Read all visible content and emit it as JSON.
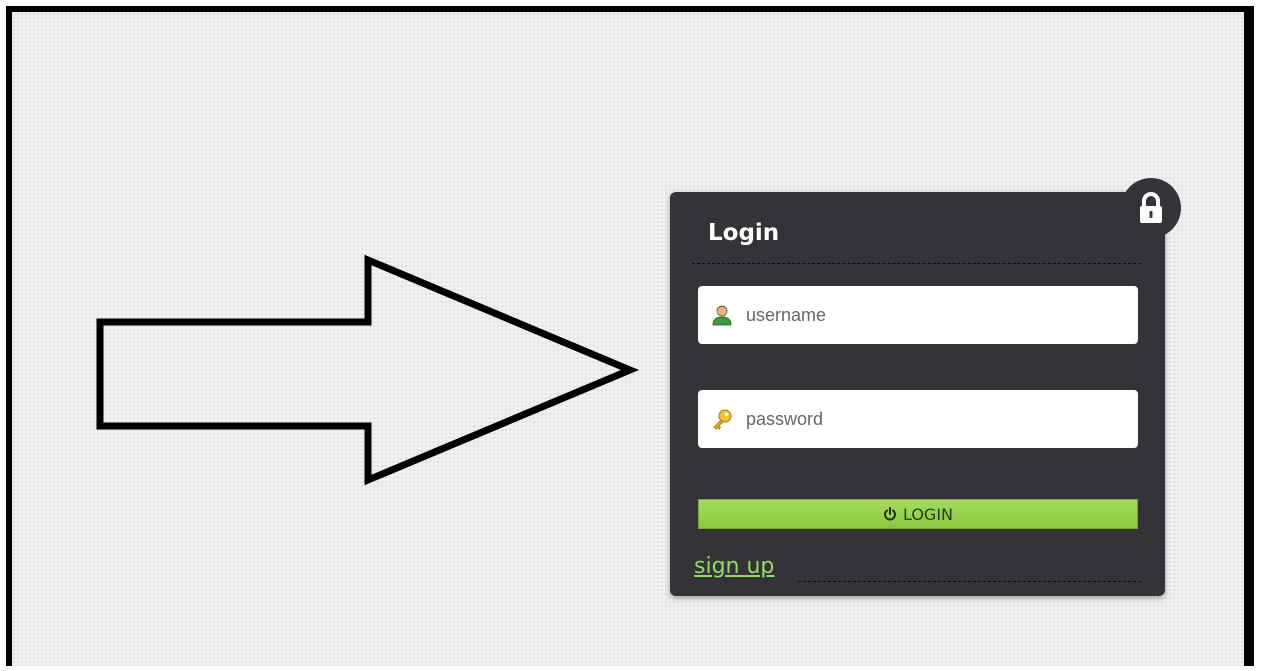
{
  "login_panel": {
    "title": "Login",
    "username": {
      "placeholder": "username",
      "value": "",
      "icon": "user-icon"
    },
    "password": {
      "placeholder": "password",
      "value": "",
      "icon": "key-icon"
    },
    "login_button": {
      "label": "LOGIN",
      "icon": "power-icon"
    },
    "signup_link": "sign up",
    "lock_icon": "lock-icon"
  },
  "colors": {
    "panel_bg": "#333338",
    "button_green": "#9ad34c",
    "link_green": "#8ee05a",
    "page_bg": "#ededed",
    "arrow_stroke": "#000000"
  }
}
